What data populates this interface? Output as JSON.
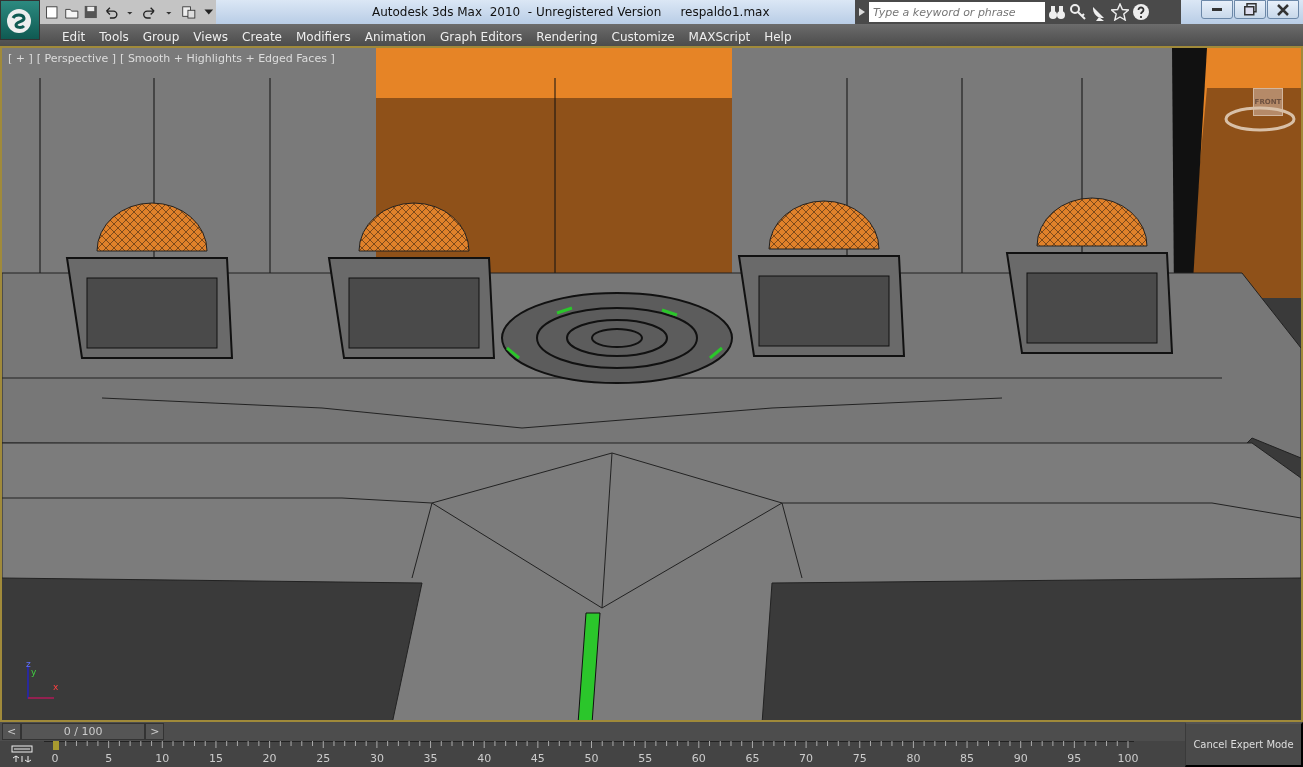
{
  "title_bar": {
    "app_title": "Autodesk 3ds Max  2010  - Unregistered Version",
    "file_name": "respaldo1.max",
    "search": {
      "placeholder": "Type a keyword or phrase"
    }
  },
  "menu": [
    "Edit",
    "Tools",
    "Group",
    "Views",
    "Create",
    "Modifiers",
    "Animation",
    "Graph Editors",
    "Rendering",
    "Customize",
    "MAXScript",
    "Help"
  ],
  "viewport": {
    "labels": [
      "[ + ]",
      "[ Perspective ]",
      "[ Smooth + Highlights + Edged Faces ]"
    ],
    "viewcube_face": "FRONT",
    "axes": [
      "z",
      "y",
      "x"
    ]
  },
  "time_slider": {
    "prev": "<",
    "frame": "0 / 100",
    "next": ">"
  },
  "track_bar": {
    "ticks": [
      "0",
      "5",
      "10",
      "15",
      "20",
      "25",
      "30",
      "35",
      "40",
      "45",
      "50",
      "55",
      "60",
      "65",
      "70",
      "75",
      "80",
      "85",
      "90",
      "95",
      "100"
    ]
  },
  "expert_mode": "Cancel Expert Mode"
}
